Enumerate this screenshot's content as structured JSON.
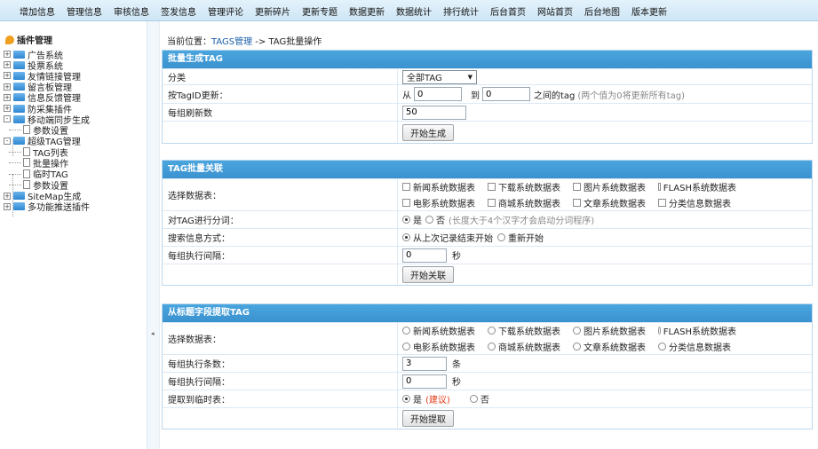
{
  "topnav": [
    "增加信息",
    "管理信息",
    "审核信息",
    "签发信息",
    "管理评论",
    "更新碎片",
    "更新专题",
    "数据更新",
    "数据统计",
    "排行统计",
    "后台首页",
    "网站首页",
    "后台地图",
    "版本更新"
  ],
  "sidebar": {
    "title": "插件管理",
    "items": [
      {
        "label": "广告系统",
        "toggle": "+"
      },
      {
        "label": "投票系统",
        "toggle": "+"
      },
      {
        "label": "友情链接管理",
        "toggle": "+"
      },
      {
        "label": "留言板管理",
        "toggle": "+"
      },
      {
        "label": "信息反馈管理",
        "toggle": "+"
      },
      {
        "label": "防采集插件",
        "toggle": "+"
      },
      {
        "label": "移动端同步生成",
        "toggle": "-"
      },
      {
        "label": "参数设置",
        "child": true
      },
      {
        "label": "超级TAG管理",
        "toggle": "-"
      },
      {
        "label": "TAG列表",
        "child": true
      },
      {
        "label": "批量操作",
        "child": true
      },
      {
        "label": "临时TAG",
        "child": true
      },
      {
        "label": "参数设置",
        "child": true
      },
      {
        "label": "SiteMap生成",
        "toggle": "+"
      },
      {
        "label": "多功能推送插件",
        "toggle": "+"
      }
    ],
    "collapse_glyph": "◂"
  },
  "breadcrumb": {
    "prefix": "当前位置：",
    "link": "TAGS管理",
    "sep": " -> ",
    "current": "TAG批量操作"
  },
  "panel1": {
    "title": "批量生成TAG",
    "category_label": "分类",
    "category_value": "全部TAG",
    "category_arrow": "▼",
    "id_label": "按TagID更新：",
    "from_text": "从",
    "from_value": "0",
    "to_text": "到",
    "to_value": "0",
    "between_text": "之间的tag",
    "between_hint": "(两个值为0将更新所有tag)",
    "per_group_label": "每组刷新数",
    "per_group_value": "50",
    "button": "开始生成"
  },
  "panel2": {
    "title": "TAG批量关联",
    "tables_label": "选择数据表：",
    "tables": [
      "新闻系统数据表",
      "下载系统数据表",
      "图片系统数据表",
      "FLASH系统数据表",
      "电影系统数据表",
      "商城系统数据表",
      "文章系统数据表",
      "分类信息数据表"
    ],
    "segment_label": "对TAG进行分词：",
    "segment_yes": "是",
    "segment_no": "否",
    "segment_hint": "(长度大于4个汉字才会启动分词程序)",
    "search_label": "搜索信息方式：",
    "search_opt1": "从上次记录结束开始",
    "search_opt2": "重新开始",
    "interval_label": "每组执行间隔：",
    "interval_value": "0",
    "interval_unit": "秒",
    "button": "开始关联"
  },
  "panel3": {
    "title": "从标题字段提取TAG",
    "tables_label": "选择数据表：",
    "tables": [
      "新闻系统数据表",
      "下载系统数据表",
      "图片系统数据表",
      "FLASH系统数据表",
      "电影系统数据表",
      "商城系统数据表",
      "文章系统数据表",
      "分类信息数据表"
    ],
    "count_label": "每组执行条数：",
    "count_value": "3",
    "count_unit": "条",
    "interval_label": "每组执行间隔：",
    "interval_value": "0",
    "interval_unit": "秒",
    "temp_label": "提取到临时表：",
    "temp_yes": "是",
    "temp_hint": "(建议)",
    "temp_no": "否",
    "button": "开始提取"
  }
}
